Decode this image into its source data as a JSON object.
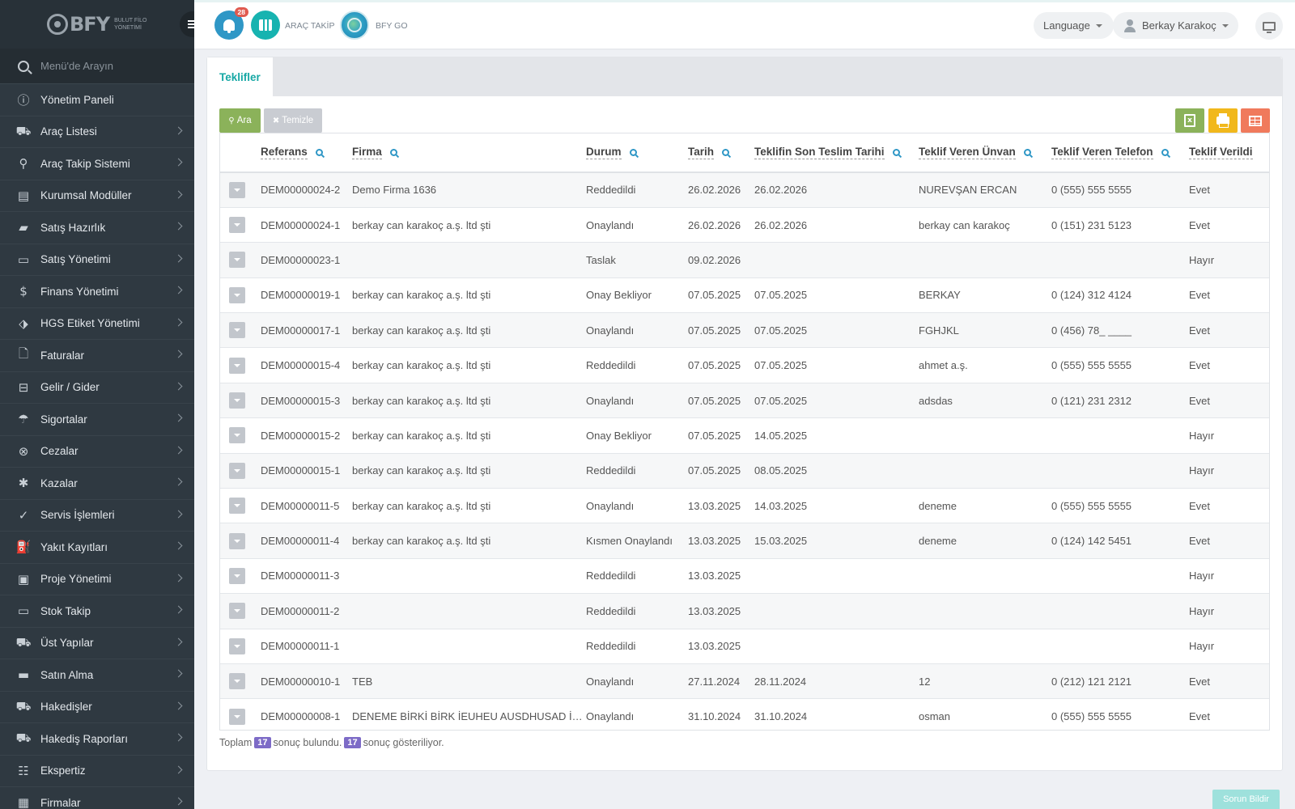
{
  "brand": {
    "name": "BFY",
    "subtitle": "BULUT FİLO YÖNETİMİ"
  },
  "sidebar": {
    "search_placeholder": "Menü'de Arayın",
    "items": [
      {
        "label": "Yönetim Paneli",
        "icon": "dashboard-icon",
        "glyph": "ⓘ",
        "chevron": false
      },
      {
        "label": "Araç Listesi",
        "icon": "car-icon",
        "glyph": "⛟",
        "chevron": true
      },
      {
        "label": "Araç Takip Sistemi",
        "icon": "map-pin-icon",
        "glyph": "⚲",
        "chevron": true
      },
      {
        "label": "Kurumsal Modüller",
        "icon": "server-icon",
        "glyph": "▤",
        "chevron": true
      },
      {
        "label": "Satış Hazırlık",
        "icon": "book-icon",
        "glyph": "▰",
        "chevron": true
      },
      {
        "label": "Satış Yönetimi",
        "icon": "card-icon",
        "glyph": "▭",
        "chevron": true
      },
      {
        "label": "Finans Yönetimi",
        "icon": "money-icon",
        "glyph": "$",
        "chevron": true
      },
      {
        "label": "HGS Etiket Yönetimi",
        "icon": "tag-icon",
        "glyph": "⬗",
        "chevron": true
      },
      {
        "label": "Faturalar",
        "icon": "file-icon",
        "glyph": "🗋",
        "chevron": true
      },
      {
        "label": "Gelir / Gider",
        "icon": "cash-icon",
        "glyph": "⊟",
        "chevron": true
      },
      {
        "label": "Sigortalar",
        "icon": "umbrella-icon",
        "glyph": "☂",
        "chevron": true
      },
      {
        "label": "Cezalar",
        "icon": "close-circle-icon",
        "glyph": "⊗",
        "chevron": true
      },
      {
        "label": "Kazalar",
        "icon": "car-crash-icon",
        "glyph": "✱",
        "chevron": true
      },
      {
        "label": "Servis İşlemleri",
        "icon": "check-circle-icon",
        "glyph": "✓",
        "chevron": true
      },
      {
        "label": "Yakıt Kayıtları",
        "icon": "gas-pump-icon",
        "glyph": "⛽",
        "chevron": true
      },
      {
        "label": "Proje Yönetimi",
        "icon": "briefcase-icon",
        "glyph": "▣",
        "chevron": true
      },
      {
        "label": "Stok Takip",
        "icon": "inbox-icon",
        "glyph": "▭",
        "chevron": true
      },
      {
        "label": "Üst Yapılar",
        "icon": "truck-icon",
        "glyph": "⛟",
        "chevron": true
      },
      {
        "label": "Satın Alma",
        "icon": "credit-card-icon",
        "glyph": "▬",
        "chevron": true
      },
      {
        "label": "Hakedişler",
        "icon": "truck-icon",
        "glyph": "⛟",
        "chevron": true
      },
      {
        "label": "Hakediş Raporları",
        "icon": "truck-icon",
        "glyph": "⛟",
        "chevron": true
      },
      {
        "label": "Ekspertiz",
        "icon": "list-icon",
        "glyph": "☷",
        "chevron": true
      },
      {
        "label": "Firmalar",
        "icon": "building-icon",
        "glyph": "▦",
        "chevron": true
      }
    ]
  },
  "topbar": {
    "notification_count": "28",
    "arac_takip_label": "ARAÇ TAKİP",
    "bfy_go_label": "BFY GO",
    "language_label": "Language",
    "user_name": "Berkay Karakoç"
  },
  "tabs": [
    {
      "label": "Teklifler",
      "active": true
    }
  ],
  "toolbar": {
    "search_label": "Ara",
    "clear_label": "Temizle"
  },
  "table": {
    "columns": [
      "Referans",
      "Firma",
      "Durum",
      "Tarih",
      "Teklifin Son Teslim Tarihi",
      "Teklif Veren Ünvan",
      "Teklif Veren Telefon",
      "Teklif Verildi"
    ],
    "rows": [
      [
        "DEM00000024-2",
        "Demo Firma 1636",
        "Reddedildi",
        "26.02.2026",
        "26.02.2026",
        "NUREVŞAN ERCAN",
        "0 (555) 555 5555",
        "Evet"
      ],
      [
        "DEM00000024-1",
        "berkay can karakoç a.ş. ltd şti",
        "Onaylandı",
        "26.02.2026",
        "26.02.2026",
        "berkay can karakoç",
        "0 (151) 231 5123",
        "Evet"
      ],
      [
        "DEM00000023-1",
        "",
        "Taslak",
        "09.02.2026",
        "",
        "",
        "",
        "Hayır"
      ],
      [
        "DEM00000019-1",
        "berkay can karakoç a.ş. ltd şti",
        "Onay Bekliyor",
        "07.05.2025",
        "07.05.2025",
        "BERKAY",
        "0 (124) 312 4124",
        "Evet"
      ],
      [
        "DEM00000017-1",
        "berkay can karakoç a.ş. ltd şti",
        "Onaylandı",
        "07.05.2025",
        "07.05.2025",
        "FGHJKL",
        "0 (456) 78_ ____",
        "Evet"
      ],
      [
        "DEM00000015-4",
        "berkay can karakoç a.ş. ltd şti",
        "Reddedildi",
        "07.05.2025",
        "07.05.2025",
        "ahmet a.ş.",
        "0 (555) 555 5555",
        "Evet"
      ],
      [
        "DEM00000015-3",
        "berkay can karakoç a.ş. ltd şti",
        "Onaylandı",
        "07.05.2025",
        "07.05.2025",
        "adsdas",
        "0 (121) 231 2312",
        "Evet"
      ],
      [
        "DEM00000015-2",
        "berkay can karakoç a.ş. ltd şti",
        "Onay Bekliyor",
        "07.05.2025",
        "14.05.2025",
        "",
        "",
        "Hayır"
      ],
      [
        "DEM00000015-1",
        "berkay can karakoç a.ş. ltd şti",
        "Reddedildi",
        "07.05.2025",
        "08.05.2025",
        "",
        "",
        "Hayır"
      ],
      [
        "DEM00000011-5",
        "berkay can karakoç a.ş. ltd şti",
        "Onaylandı",
        "13.03.2025",
        "14.03.2025",
        "deneme",
        "0 (555) 555 5555",
        "Evet"
      ],
      [
        "DEM00000011-4",
        "berkay can karakoç a.ş. ltd şti",
        "Kısmen Onaylandı",
        "13.03.2025",
        "15.03.2025",
        "deneme",
        "0 (124) 142 5451",
        "Evet"
      ],
      [
        "DEM00000011-3",
        "",
        "Reddedildi",
        "13.03.2025",
        "",
        "",
        "",
        "Hayır"
      ],
      [
        "DEM00000011-2",
        "",
        "Reddedildi",
        "13.03.2025",
        "",
        "",
        "",
        "Hayır"
      ],
      [
        "DEM00000011-1",
        "",
        "Reddedildi",
        "13.03.2025",
        "",
        "",
        "",
        "Hayır"
      ],
      [
        "DEM00000010-1",
        "TEB",
        "Onaylandı",
        "27.11.2024",
        "28.11.2024",
        "12",
        "0 (212) 121 2121",
        "Evet"
      ],
      [
        "DEM00000008-1",
        "DENEME BİRKİ BİRK İEUHEU AUSDHUSAD İŞ…",
        "Onaylandı",
        "31.10.2024",
        "31.10.2024",
        "osman",
        "0 (555) 555 5555",
        "Evet"
      ]
    ]
  },
  "summary": {
    "prefix": "Toplam",
    "total": "17",
    "middle": "sonuç bulundu.",
    "shown": "17",
    "suffix": "sonuç gösteriliyor."
  },
  "report_button": "Sorun Bildir",
  "colors": {
    "sidebar": "#2f3941",
    "accent": "#17a8a5",
    "ara": "#8bb25a",
    "print": "#f1b81c",
    "grid": "#f07a5c",
    "badge": "#7d6bc7"
  }
}
